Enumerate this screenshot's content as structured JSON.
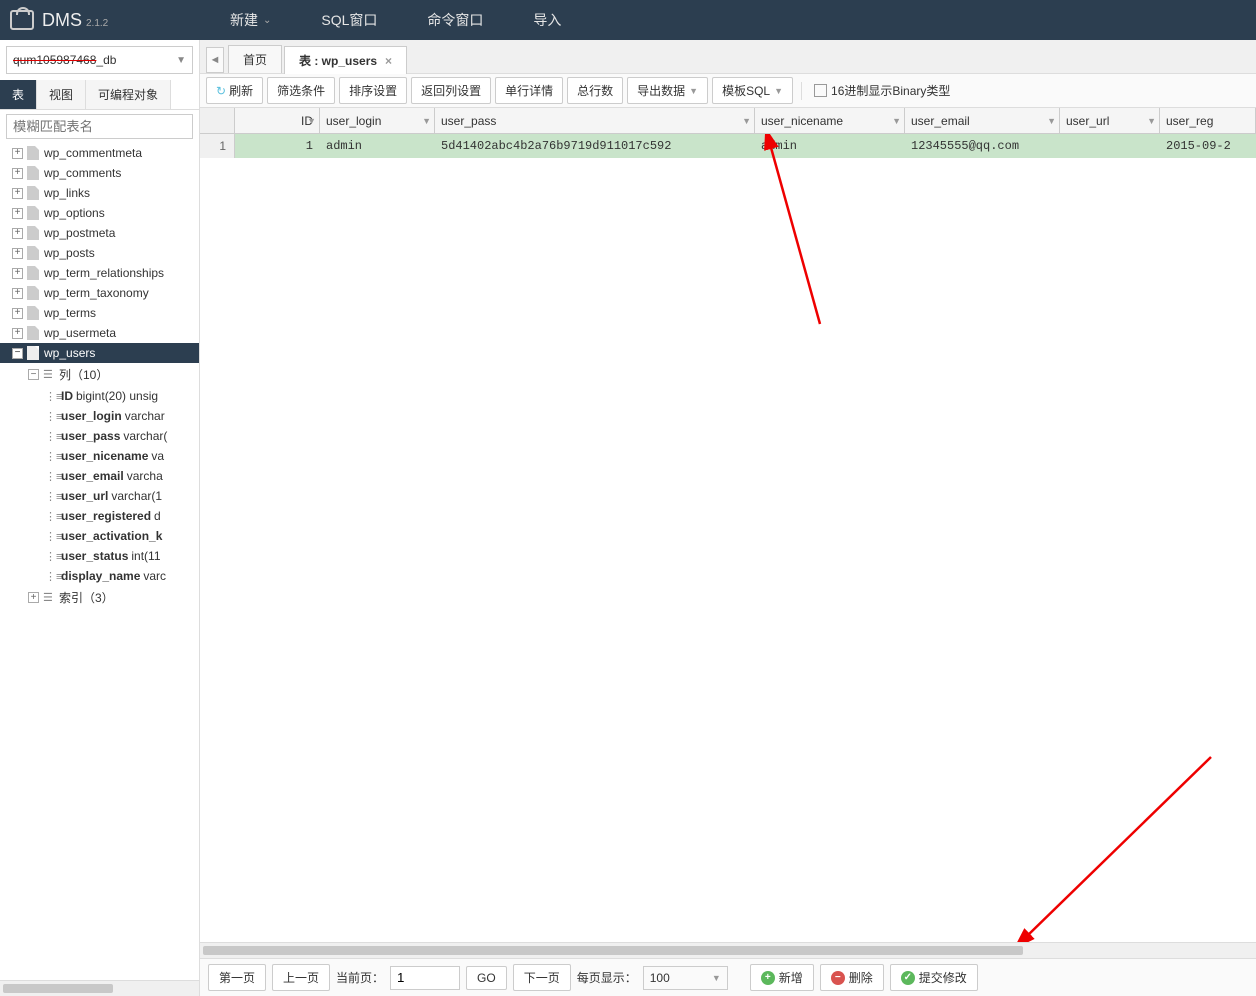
{
  "app": {
    "name": "DMS",
    "version": "2.1.2"
  },
  "menu": {
    "new": "新建",
    "sql": "SQL窗口",
    "cmd": "命令窗口",
    "import": "导入"
  },
  "db": {
    "redacted": "qum105987468",
    "suffix": "_db"
  },
  "sideTabs": {
    "table": "表",
    "view": "视图",
    "prog": "可编程对象"
  },
  "filterPlaceholder": "模糊匹配表名",
  "tables": [
    "wp_commentmeta",
    "wp_comments",
    "wp_links",
    "wp_options",
    "wp_postmeta",
    "wp_posts",
    "wp_term_relationships",
    "wp_term_taxonomy",
    "wp_terms",
    "wp_usermeta",
    "wp_users"
  ],
  "columnsHeader": "列（10）",
  "indexHeader": "索引（3）",
  "columns": [
    {
      "n": "ID",
      "t": "bigint(20) unsig"
    },
    {
      "n": "user_login",
      "t": "varchar"
    },
    {
      "n": "user_pass",
      "t": "varchar("
    },
    {
      "n": "user_nicename",
      "t": "va"
    },
    {
      "n": "user_email",
      "t": "varcha"
    },
    {
      "n": "user_url",
      "t": "varchar(1"
    },
    {
      "n": "user_registered",
      "t": "d"
    },
    {
      "n": "user_activation_k",
      "t": ""
    },
    {
      "n": "user_status",
      "t": "int(11"
    },
    {
      "n": "display_name",
      "t": "varc"
    }
  ],
  "tabs": {
    "home": "首页",
    "active": "表 : wp_users"
  },
  "toolbar": {
    "refresh": "刷新",
    "filter": "筛选条件",
    "sort": "排序设置",
    "retcol": "返回列设置",
    "detail": "单行详情",
    "count": "总行数",
    "export": "导出数据",
    "tmpl": "模板SQL",
    "hexLabel": "16进制显示Binary类型"
  },
  "grid": {
    "headers": [
      "ID",
      "user_login",
      "user_pass",
      "user_nicename",
      "user_email",
      "user_url",
      "user_reg"
    ],
    "row": {
      "num": "1",
      "id": "1",
      "user_login": "admin",
      "user_pass": "5d41402abc4b2a76b9719d911017c592",
      "user_nicename": "admin",
      "user_email": "12345555@qq.com",
      "user_url": "",
      "user_reg": "2015-09-2"
    }
  },
  "footer": {
    "first": "第一页",
    "prev": "上一页",
    "curLabel": "当前页：",
    "curVal": "1",
    "go": "GO",
    "next": "下一页",
    "perLabel": "每页显示：",
    "perVal": "100",
    "add": "新增",
    "del": "删除",
    "commit": "提交修改"
  }
}
